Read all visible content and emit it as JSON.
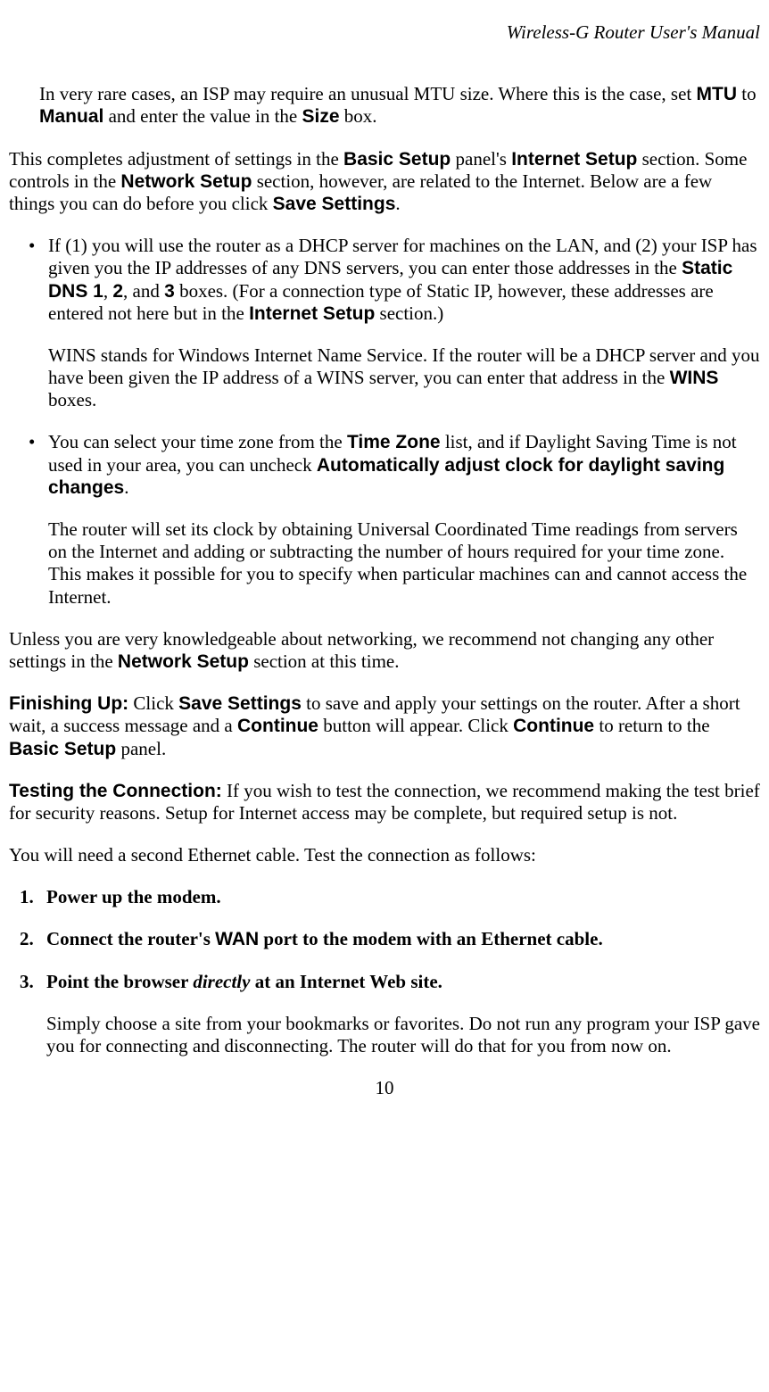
{
  "header": "Wireless-G Router User's Manual",
  "p1": {
    "t1": "In very rare cases, an ISP may require an unusual MTU size. Where this is the case, set ",
    "b1": "MTU",
    "t2": " to ",
    "b2": "Manual",
    "t3": " and enter the value in the ",
    "b3": "Size",
    "t4": " box."
  },
  "p2": {
    "t1": "This completes adjustment of settings in the ",
    "b1": "Basic Setup",
    "t2": " panel's ",
    "b2": "Internet Setup",
    "t3": " section. Some controls in the ",
    "b3": "Network Setup",
    "t4": " section, however, are related to the Internet. Below are a few things you can do before you click ",
    "b4": "Save Settings",
    "t5": "."
  },
  "li1": {
    "t1": "If (1) you will use the router as a DHCP server for machines on the LAN, and (2) your ISP has given you the IP addresses of any DNS servers, you can enter those addresses in the ",
    "b1": "Static DNS 1",
    "t2": ", ",
    "b2": "2",
    "t3": ", and ",
    "b3": "3",
    "t4": " boxes. (For a connection type of Static IP, however, these addresses are entered not here but in the ",
    "b4": "Internet Setup",
    "t5": " section.)",
    "sub_t1": "WINS stands for Windows Internet Name Service. If the router will be a DHCP server and you have been given the IP address of a WINS server, you can enter that address in the ",
    "sub_b1": "WINS",
    "sub_t2": " boxes."
  },
  "li2": {
    "t1": "You can select your time zone from the ",
    "b1": "Time Zone",
    "t2": " list, and if Daylight Saving Time is not used in your area, you can uncheck ",
    "b2": "Automatically adjust clock for daylight saving changes",
    "t3": ".",
    "sub": "The router will set its clock by obtaining Universal Coordinated Time readings from servers on the Internet and adding or subtracting the number of hours required for your time zone. This makes it possible for you to specify when particular machines can and cannot access the Internet."
  },
  "p3": {
    "t1": "Unless you are very knowledgeable about networking, we recommend not changing any other settings in the ",
    "b1": "Network Setup",
    "t2": " section at this time."
  },
  "p4": {
    "lead": "Finishing Up:",
    "t1": " Click ",
    "b1": "Save Settings",
    "t2": " to save and apply your settings on the router. After a short wait, a success message and a ",
    "b2": "Continue",
    "t3": " button will appear. Click ",
    "b3": "Continue",
    "t4": " to return to the ",
    "b4": "Basic Setup",
    "t5": " panel."
  },
  "p5": {
    "lead": "Testing the Connection:",
    "t1": " If you wish to test the connection, we recommend making the test brief for security reasons. Setup for Internet access may be complete, but required setup is not."
  },
  "p6": "You will need a second Ethernet cable. Test the connection as follows:",
  "s1": "Power up the modem.",
  "s2": {
    "t1": "Connect the router's ",
    "b1": "WAN",
    "t2": " port to the modem with an Ethernet cable."
  },
  "s3": {
    "t1": "Point the browser ",
    "i1": "directly",
    "t2": " at an Internet Web site.",
    "body": "Simply choose a site from your bookmarks or favorites. Do not run any program your ISP gave you for connecting and disconnecting. The router will do that for you from now on."
  },
  "page_number": "10"
}
